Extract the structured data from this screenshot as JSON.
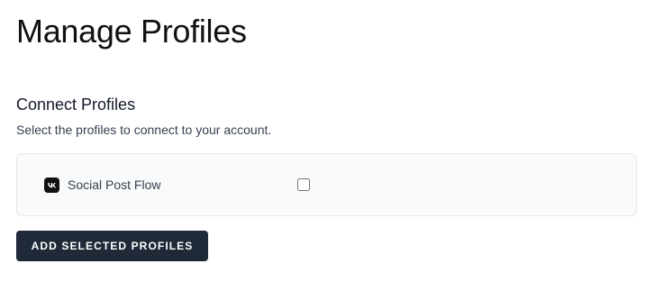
{
  "page": {
    "title": "Manage Profiles"
  },
  "connect_section": {
    "title": "Connect Profiles",
    "description": "Select the profiles to connect to your account."
  },
  "profiles": [
    {
      "name": "Social Post Flow",
      "icon": "vk-icon",
      "checked": false
    }
  ],
  "actions": {
    "add_selected_label": "ADD SELECTED PROFILES"
  },
  "colors": {
    "button_bg": "#1f2937",
    "list_bg": "#f9fafb",
    "list_border": "#e5e7eb"
  }
}
